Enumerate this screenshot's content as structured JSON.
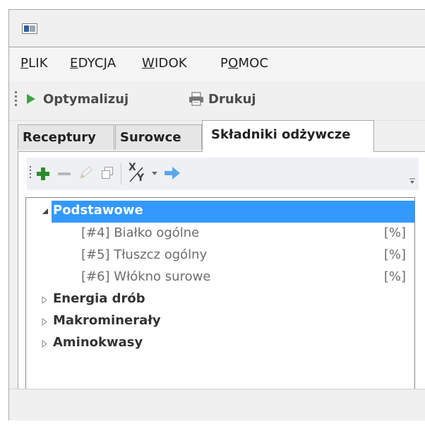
{
  "menu": {
    "items": [
      {
        "pre": "",
        "ul": "P",
        "post": "LIK"
      },
      {
        "pre": "",
        "ul": "E",
        "post": "DYCJA"
      },
      {
        "pre": "",
        "ul": "W",
        "post": "IDOK"
      },
      {
        "pre": "P",
        "ul": "O",
        "post": "MOC"
      }
    ]
  },
  "toolbar": {
    "optimize_label": "Optymalizuj",
    "print_label": "Drukuj"
  },
  "tabs": [
    "Receptury",
    "Surowce",
    "Składniki odżywcze"
  ],
  "active_tab": 2,
  "subtoolbar": {
    "icons": [
      "add-icon",
      "remove-icon",
      "edit-icon",
      "copy-icon",
      "formula-icon",
      "dropdown-icon",
      "arrow-right-icon",
      "overflow-icon"
    ],
    "formula_label_top": "X",
    "formula_label_bottom": "Y"
  },
  "tree": {
    "groups": [
      {
        "label": "Podstawowe",
        "expanded": true,
        "selected": true,
        "children": [
          {
            "label": "[#4] Białko ogólne",
            "unit": "[%]"
          },
          {
            "label": "[#5] Tłuszcz ogólny",
            "unit": "[%]"
          },
          {
            "label": "[#6] Włókno surowe",
            "unit": "[%]"
          }
        ]
      },
      {
        "label": "Energia drób",
        "expanded": false
      },
      {
        "label": "Makrominerały",
        "expanded": false
      },
      {
        "label": "Aminokwasy",
        "expanded": false
      }
    ]
  },
  "colors": {
    "selection": "#3399ff",
    "play_green": "#3fa13f",
    "add_green": "#2e8b2e",
    "arrow_blue": "#5aa8e8"
  }
}
